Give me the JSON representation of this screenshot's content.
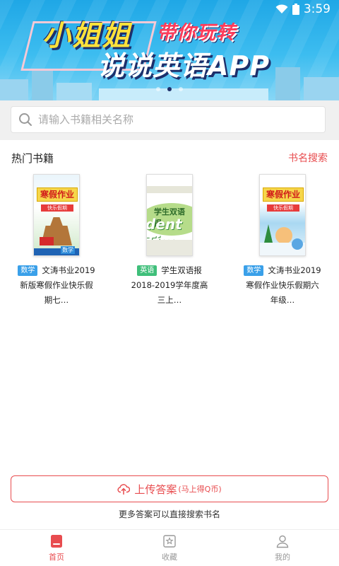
{
  "status_bar": {
    "time": "3:59",
    "wifi_icon": "wifi-icon",
    "battery_icon": "battery-icon"
  },
  "banner": {
    "line1": "小姐姐",
    "line2": "带你玩转",
    "line3": "说说英语APP",
    "carousel_active_index": 1,
    "carousel_count": 3
  },
  "search": {
    "placeholder": "请输入书籍相关名称",
    "value": "",
    "icon": "search-icon"
  },
  "hot_books": {
    "title": "热门书籍",
    "link": "书名搜索",
    "items": [
      {
        "tag": "数学",
        "name": "文涛书业2019新版寒假作业快乐假期七…",
        "cover_title": "寒假作业",
        "cover_sub": "快乐假期",
        "cover_badge": "数学"
      },
      {
        "tag": "英语",
        "name": "学生双语报2018-2019学年度高三上…",
        "cover_title": "学生双语报",
        "cover_big": "dent Tim"
      },
      {
        "tag": "数学",
        "name": "文涛书业2019寒假作业快乐假期六年级…",
        "cover_title": "寒假作业",
        "cover_sub": "快乐假期"
      }
    ]
  },
  "upload": {
    "label": "上传答案",
    "sub": "(马上得Q币)",
    "icon": "cloud-upload-icon"
  },
  "hint": "更多答案可以直接搜索书名",
  "tabs": [
    {
      "label": "首页",
      "icon": "home-book-icon",
      "active": true
    },
    {
      "label": "收藏",
      "icon": "star-icon",
      "active": false
    },
    {
      "label": "我的",
      "icon": "user-icon",
      "active": false
    }
  ],
  "colors": {
    "accent": "#e84c4f",
    "banner_blue": "#1fa7e6",
    "tag_math": "#3aa0e9",
    "tag_english": "#3fbf7a"
  }
}
